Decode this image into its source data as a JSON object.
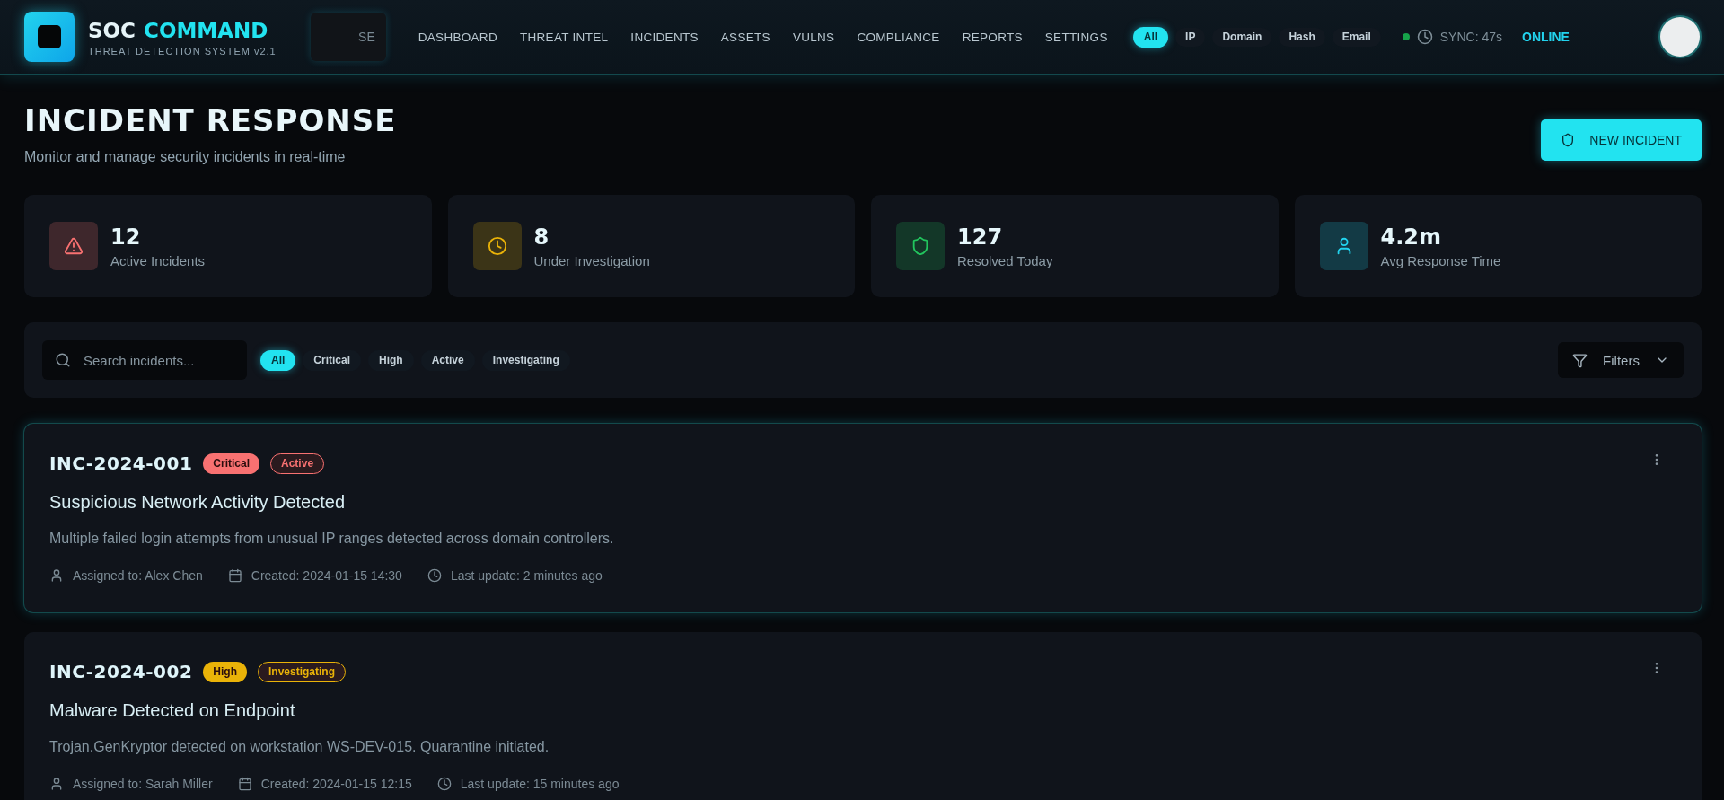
{
  "brand": {
    "title": "SOC",
    "title_accent": "COMMAND",
    "subtitle": "THREAT DETECTION SYSTEM v2.1"
  },
  "header_search": {
    "placeholder": "SE"
  },
  "nav": [
    {
      "label": "DASHBOARD",
      "selected": false
    },
    {
      "label": "THREAT INTEL",
      "selected": false
    },
    {
      "label": "INCIDENTS",
      "selected": false
    },
    {
      "label": "ASSETS",
      "selected": false
    },
    {
      "label": "VULNS",
      "selected": false
    },
    {
      "label": "COMPLIANCE",
      "selected": false
    },
    {
      "label": "REPORTS",
      "selected": false
    },
    {
      "label": "SETTINGS",
      "selected": false
    }
  ],
  "indicator_filters": [
    {
      "label": "All",
      "selected": true
    },
    {
      "label": "IP",
      "selected": false
    },
    {
      "label": "Domain",
      "selected": false
    },
    {
      "label": "Hash",
      "selected": false
    },
    {
      "label": "Email",
      "selected": false
    }
  ],
  "sync": {
    "color": "#16a34a",
    "text": "SYNC: 47s",
    "state": "ONLINE"
  },
  "page": {
    "title": "INCIDENT RESPONSE",
    "subtitle": "Monitor and manage security incidents in real-time",
    "action": "NEW INCIDENT"
  },
  "stats": [
    {
      "kind": "alert",
      "color": "#f87171",
      "value": "12",
      "label": "Active Incidents"
    },
    {
      "kind": "pending",
      "color": "#eab308",
      "value": "8",
      "label": "Under Investigation"
    },
    {
      "kind": "resolved",
      "color": "#22c55e",
      "value": "127",
      "label": "Resolved Today"
    },
    {
      "kind": "response",
      "color": "#22d3ee",
      "value": "4.2m",
      "label": "Avg Response Time"
    }
  ],
  "filter_bar": {
    "search": {
      "placeholder": "Search incidents..."
    },
    "chips": [
      {
        "label": "All",
        "selected": true
      },
      {
        "label": "Critical",
        "selected": false
      },
      {
        "label": "High",
        "selected": false
      },
      {
        "label": "Active",
        "selected": false
      },
      {
        "label": "Investigating",
        "selected": false
      }
    ],
    "filters_button": "Filters"
  },
  "incidents": [
    {
      "id": "INC-2024-001",
      "highlighted": true,
      "severity": {
        "label": "Critical",
        "color": "#f87171"
      },
      "status": {
        "label": "Active",
        "color": "#f87171"
      },
      "title": "Suspicious Network Activity Detected",
      "description": "Multiple failed login attempts from unusual IP ranges detected across domain controllers.",
      "assigned": "Assigned to: Alex Chen",
      "created": "Created: 2024-01-15 14:30",
      "updated": "Last update: 2 minutes ago"
    },
    {
      "id": "INC-2024-002",
      "highlighted": false,
      "severity": {
        "label": "High",
        "color": "#eab308"
      },
      "status": {
        "label": "Investigating",
        "color": "#eab308"
      },
      "title": "Malware Detected on Endpoint",
      "description": "Trojan.GenKryptor detected on workstation WS-DEV-015. Quarantine initiated.",
      "assigned": "Assigned to: Sarah Miller",
      "created": "Created: 2024-01-15 12:15",
      "updated": "Last update: 15 minutes ago"
    }
  ]
}
